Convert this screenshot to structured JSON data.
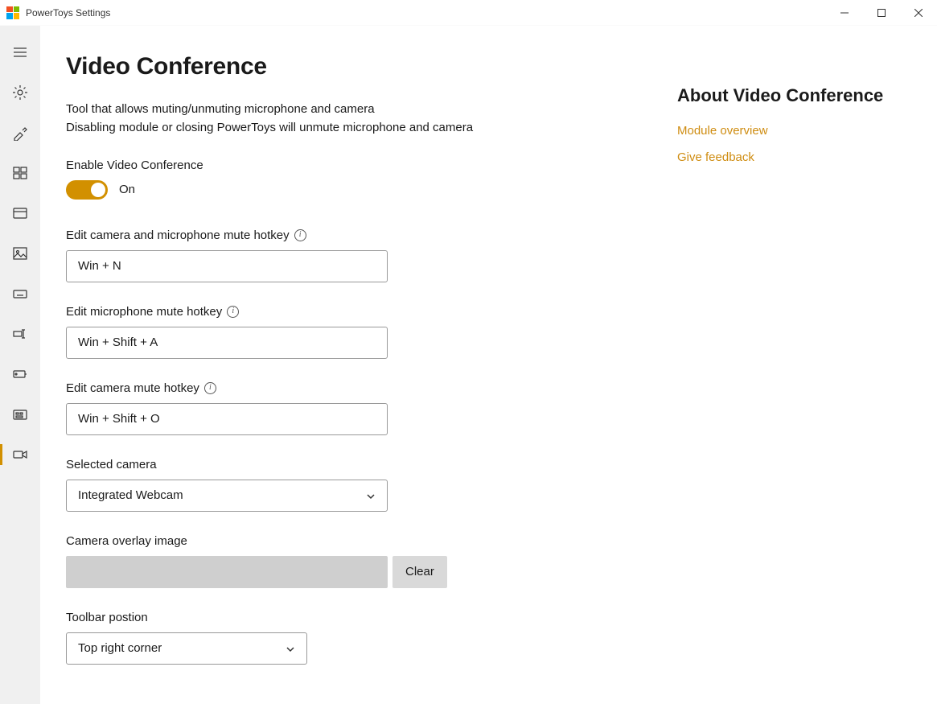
{
  "window": {
    "title": "PowerToys Settings"
  },
  "sidebar": {
    "items": [
      {
        "id": "menu"
      },
      {
        "id": "general"
      },
      {
        "id": "colorpicker"
      },
      {
        "id": "fancyzones"
      },
      {
        "id": "fileexplorer"
      },
      {
        "id": "imageresizer"
      },
      {
        "id": "keyboard"
      },
      {
        "id": "powerrename"
      },
      {
        "id": "run"
      },
      {
        "id": "shortcutguide"
      },
      {
        "id": "videoconference",
        "active": true
      }
    ]
  },
  "page": {
    "title": "Video Conference",
    "desc_line1": "Tool that allows muting/unmuting microphone and camera",
    "desc_line2": "Disabling module or closing PowerToys will unmute microphone and camera",
    "enable_label": "Enable Video Conference",
    "enable_state": "On",
    "hotkey_both_label": "Edit camera and microphone mute hotkey",
    "hotkey_both_value": "Win + N",
    "hotkey_mic_label": "Edit microphone mute hotkey",
    "hotkey_mic_value": "Win + Shift + A",
    "hotkey_cam_label": "Edit camera mute hotkey",
    "hotkey_cam_value": "Win + Shift + O",
    "selected_camera_label": "Selected camera",
    "selected_camera_value": "Integrated Webcam",
    "overlay_label": "Camera overlay image",
    "overlay_value": "",
    "clear_label": "Clear",
    "toolbar_label": "Toolbar postion",
    "toolbar_value": "Top right corner"
  },
  "aside": {
    "title": "About Video Conference",
    "link_overview": "Module overview",
    "link_feedback": "Give feedback"
  }
}
